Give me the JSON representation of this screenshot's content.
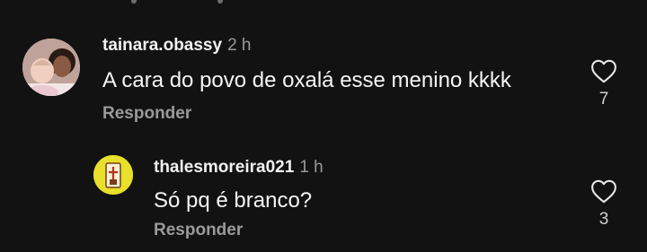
{
  "comments": [
    {
      "username": "tainara.obassy",
      "time": "2 h",
      "text": "A cara do povo de oxalá esse menino kkkk",
      "reply_label": "Responder",
      "likes": "7"
    },
    {
      "username": "thalesmoreira021",
      "time": "1 h",
      "text": "Só pq é branco?",
      "reply_label": "Responder",
      "likes": "3"
    }
  ],
  "colors": {
    "background": "#121212",
    "text": "#f2f2f2",
    "muted": "#9a9a9a"
  },
  "icons": {
    "like": "heart-outline-icon"
  }
}
